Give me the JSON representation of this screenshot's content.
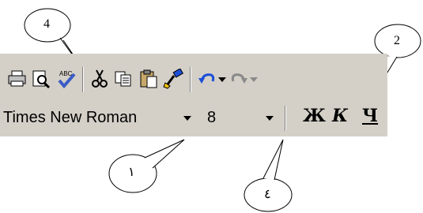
{
  "font": {
    "name": "Times New Roman",
    "size": "8"
  },
  "formatting": {
    "bold_label": "Ж",
    "italic_label": "К",
    "underline_label": "Ч"
  },
  "callouts": [
    {
      "label": "4"
    },
    {
      "label": "2"
    },
    {
      "label": "١"
    },
    {
      "label": "٤"
    }
  ],
  "icons": {
    "print": "print-icon",
    "preview": "print-preview-icon",
    "spelling": "spelling-check-icon",
    "cut": "cut-icon",
    "copy": "copy-icon",
    "paste": "paste-icon",
    "format_painter": "format-painter-icon",
    "undo": "undo-icon",
    "redo": "redo-icon"
  },
  "colors": {
    "toolbar_bg": "#d4d0c8",
    "accent_blue": "#1c4fd6",
    "check_blue": "#3b5cc4"
  }
}
